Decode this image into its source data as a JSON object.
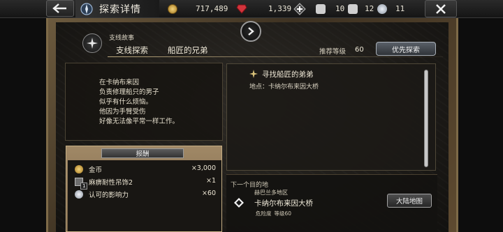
{
  "topbar": {
    "title": "探索详情",
    "gold": "717,489",
    "gems": "1,339",
    "stat_a": "10",
    "stat_b": "12",
    "stat_c": "11",
    "icon_labels": [
      "钥",
      "钥",
      "钥"
    ]
  },
  "quest": {
    "type_label": "支线故事",
    "category": "支线探索",
    "name": "船匠的兄弟",
    "recommend_label": "推荐等级",
    "recommend_level": "60",
    "priority_button": "优先探索"
  },
  "story": {
    "lines": [
      "在卡纳布来因",
      "负责修理船只的男子",
      "似乎有什么烦恼。",
      "他因为手臂受伤",
      "好像无法像平常一样工作。"
    ]
  },
  "rewards": {
    "title": "报酬",
    "items": [
      {
        "name": "金币",
        "amount": "×3,000",
        "icon": "coin-icon"
      },
      {
        "name": "麻痹耐性吊饰2",
        "amount": "×1",
        "icon": "charm-icon",
        "badge": "1"
      },
      {
        "name": "认可的影响力",
        "amount": "×60",
        "icon": "influence-icon"
      }
    ]
  },
  "objective": {
    "title": "寻找船匠的弟弟",
    "location": "地点：卡纳尔布来因大桥"
  },
  "destination": {
    "label": "下一个目的地",
    "region": "赫巴兰多地区",
    "name": "卡纳尔布来因大桥",
    "danger_label": "危险度",
    "level": "等级60",
    "map_button": "大陆地图"
  },
  "colors": {
    "accent_gold": "#bba77c",
    "frame_bronze": "#6c5a3e"
  }
}
